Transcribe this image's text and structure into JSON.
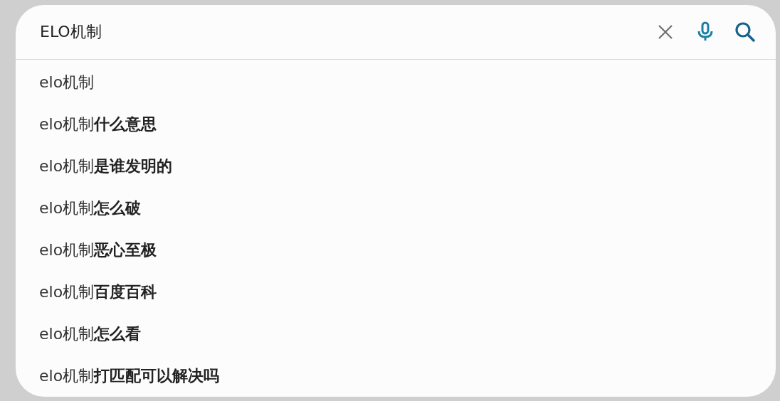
{
  "search": {
    "value": "ELO机制"
  },
  "suggestions": [
    {
      "text": "elo机制"
    },
    {
      "text": "elo机制**什么意思**"
    },
    {
      "text": "elo机制**是谁发明的**"
    },
    {
      "text": "elo机制**怎么破**"
    },
    {
      "text": "elo机制**恶心至极**"
    },
    {
      "text": "elo机制**百度百科**"
    },
    {
      "text": "elo机制**怎么看**"
    },
    {
      "text": "elo机制**打匹配可以解决吗**"
    }
  ]
}
